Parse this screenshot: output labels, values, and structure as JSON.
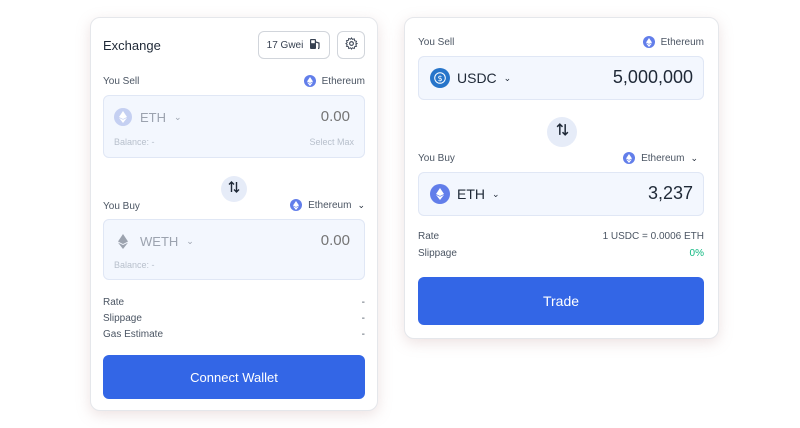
{
  "left": {
    "title": "Exchange",
    "gas_chip": "17 Gwei",
    "sell": {
      "label": "You Sell",
      "network": "Ethereum",
      "token": "ETH",
      "amount": "0.00",
      "balance": "Balance: -",
      "select_max": "Select Max"
    },
    "buy": {
      "label": "You Buy",
      "network": "Ethereum",
      "token": "WETH",
      "amount": "0.00",
      "balance": "Balance: -"
    },
    "details": [
      {
        "label": "Rate",
        "value": "-"
      },
      {
        "label": "Slippage",
        "value": "-"
      },
      {
        "label": "Gas Estimate",
        "value": "-"
      }
    ],
    "button": "Connect Wallet"
  },
  "right": {
    "sell": {
      "label": "You Sell",
      "network": "Ethereum",
      "token": "USDC",
      "amount": "5,000,000"
    },
    "buy": {
      "label": "You Buy",
      "network": "Ethereum",
      "token": "ETH",
      "amount": "3,237"
    },
    "details": [
      {
        "label": "Rate",
        "value": "1 USDC = 0.0006 ETH"
      },
      {
        "label": "Slippage",
        "value": "0%"
      }
    ],
    "button": "Trade"
  },
  "colors": {
    "accent": "#3366e6",
    "eth": "#627eea",
    "usdc": "#2775ca",
    "positive": "#10b981",
    "input_bg": "#f3f7fe"
  }
}
